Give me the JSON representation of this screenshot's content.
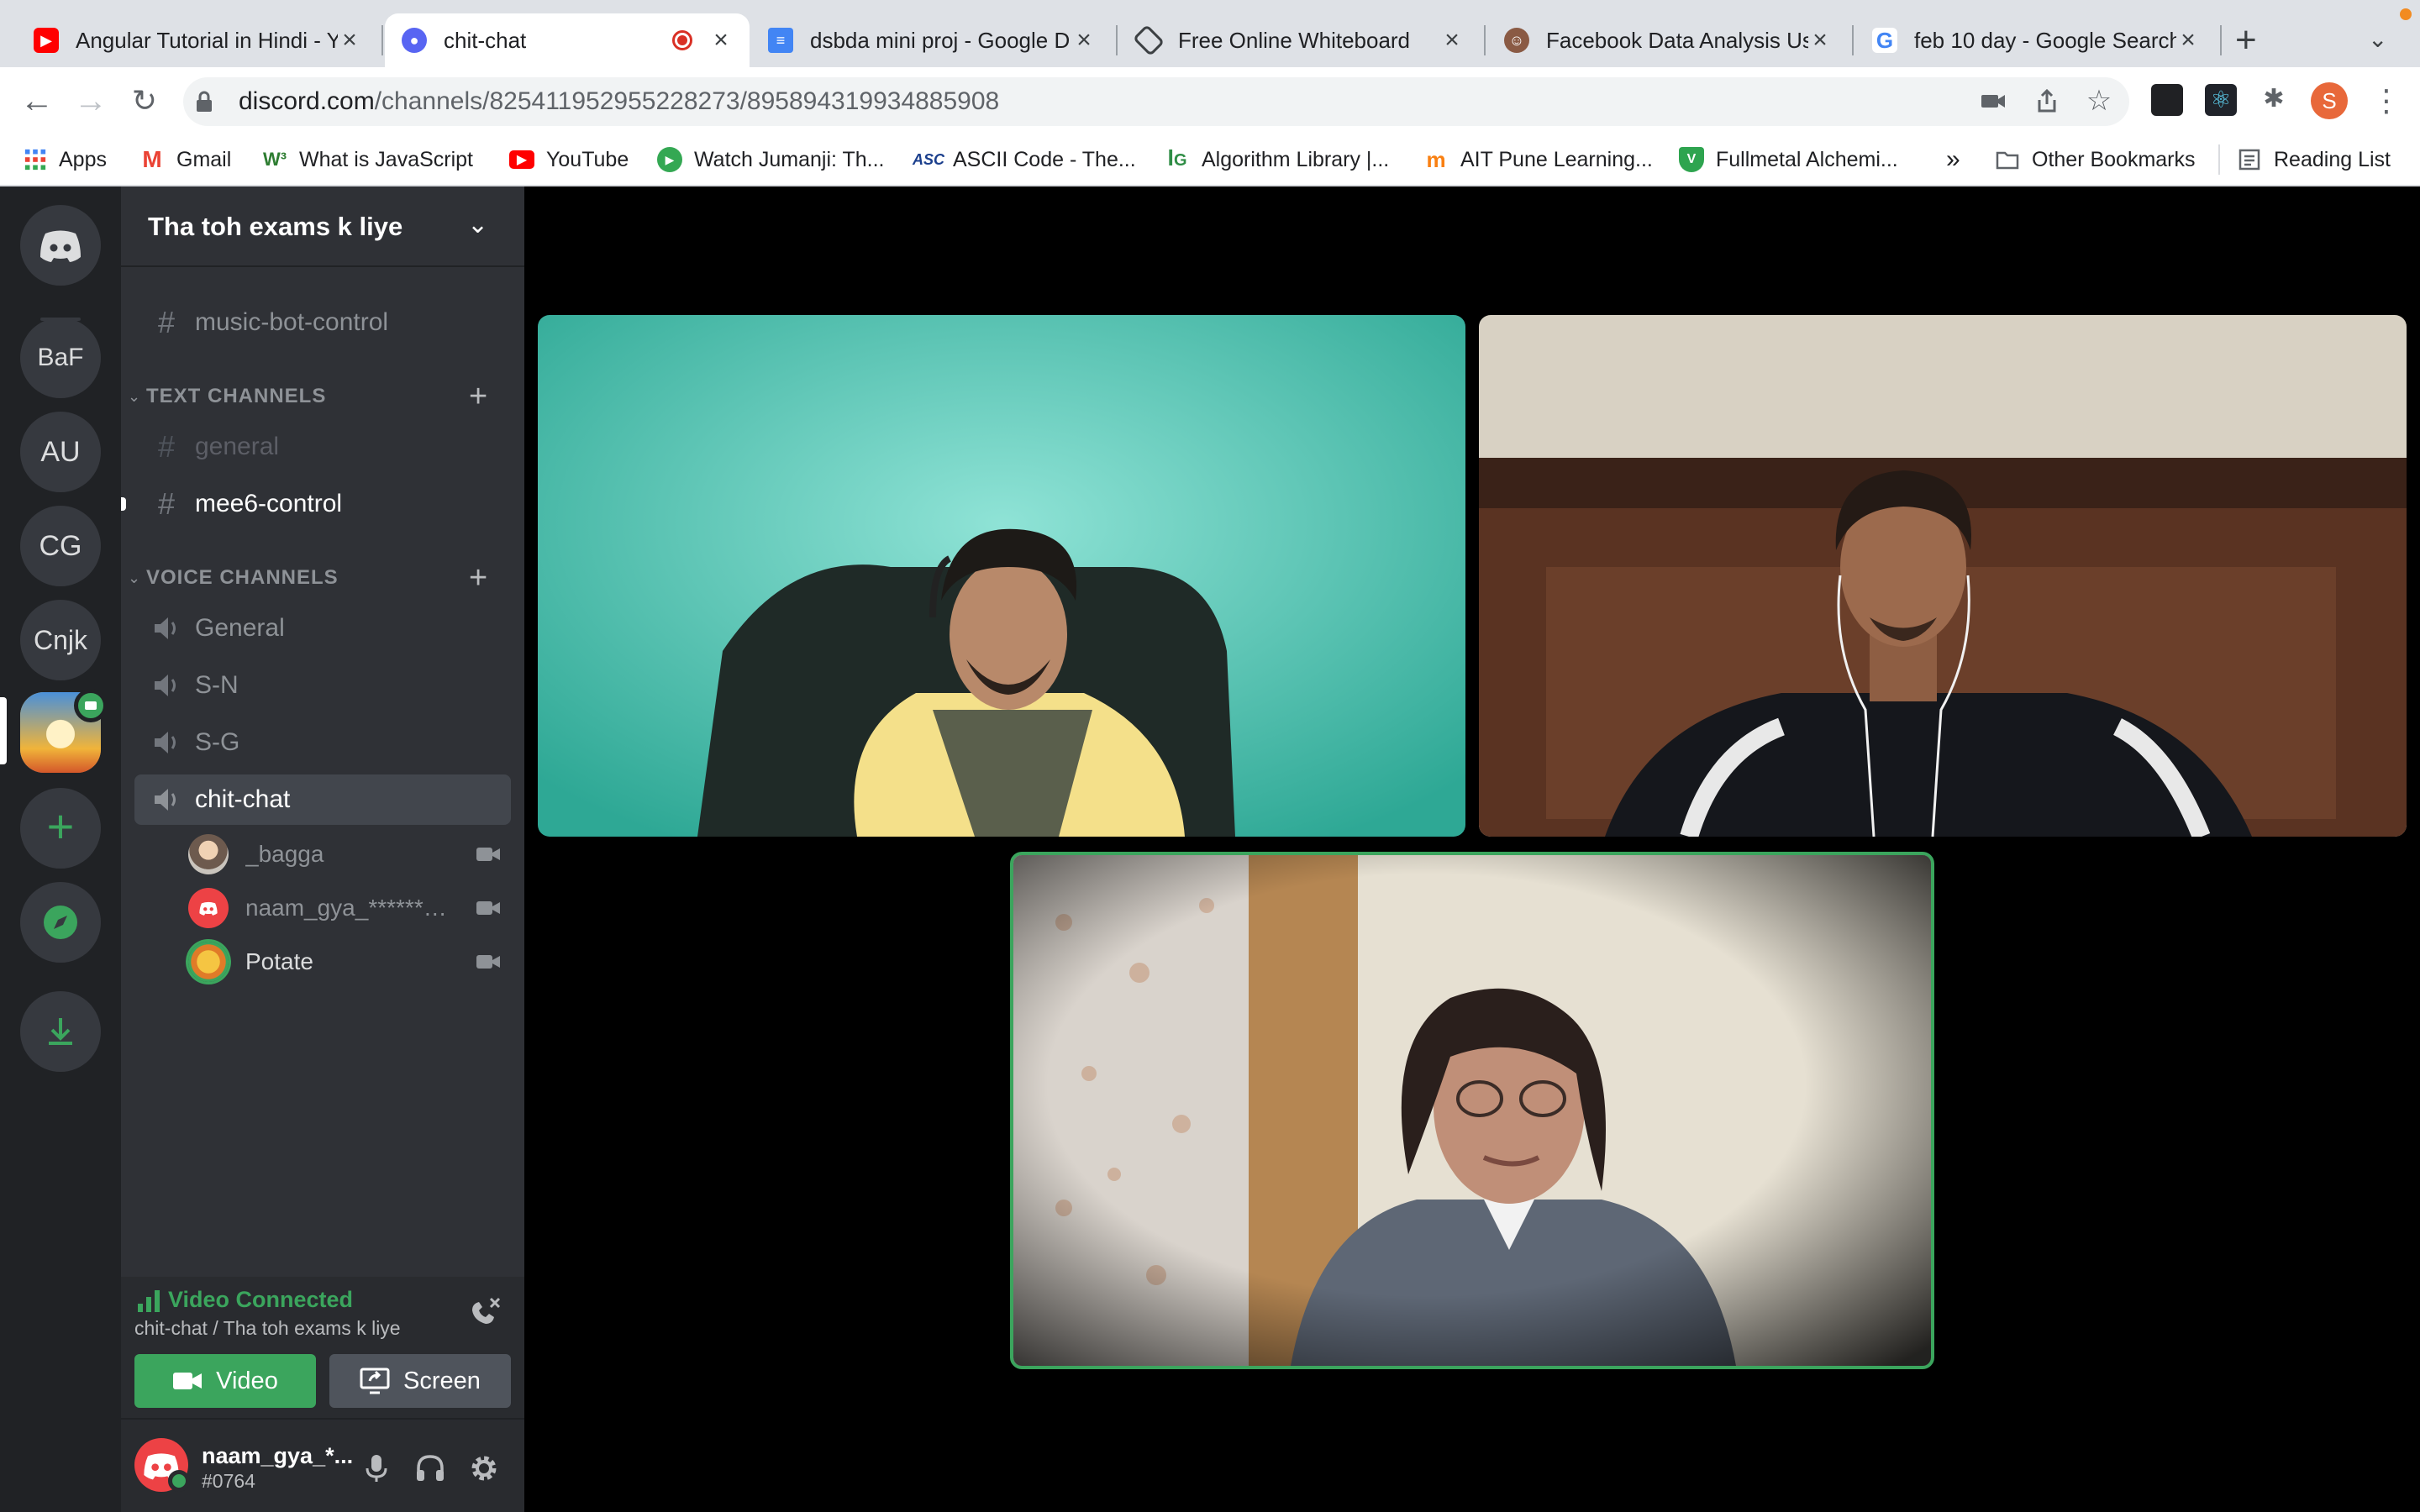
{
  "browser": {
    "tabs": [
      {
        "title": "Angular Tutorial in Hindi - Y",
        "favicon": "youtube-icon",
        "color": "#ff0000"
      },
      {
        "title": "chit-chat",
        "favicon": "discord-icon",
        "color": "#5865f2",
        "recording": true
      },
      {
        "title": "dsbda mini proj - Google D",
        "favicon": "google-docs-icon",
        "color": "#4285f4"
      },
      {
        "title": "Free Online Whiteboard",
        "favicon": "whiteboard-icon",
        "color": "#3c4043"
      },
      {
        "title": "Facebook Data Analysis Us",
        "favicon": "avatar-icon",
        "color": "#8a5a44"
      },
      {
        "title": "feb 10 day - Google Search",
        "favicon": "google-icon",
        "color": "#4285f4"
      }
    ],
    "address": {
      "host": "discord.com",
      "path": "/channels/825411952955228273/895894319934885908"
    },
    "profile_initial": "S",
    "bookmarks": [
      {
        "label": "Apps",
        "icon": "apps-grid-icon"
      },
      {
        "label": "Gmail",
        "icon": "gmail-icon"
      },
      {
        "label": "What is JavaScript",
        "icon": "w3-icon"
      },
      {
        "label": "YouTube",
        "icon": "youtube-icon"
      },
      {
        "label": "Watch Jumanji: Th...",
        "icon": "play-icon"
      },
      {
        "label": "ASCII Code - The...",
        "icon": "ascii-icon"
      },
      {
        "label": "Algorithm Library |...",
        "icon": "gfg-icon"
      },
      {
        "label": "AIT Pune Learning...",
        "icon": "moodle-icon"
      },
      {
        "label": "Fullmetal Alchemi...",
        "icon": "shield-icon"
      }
    ],
    "overflow_label": "»",
    "other_bookmarks": "Other Bookmarks",
    "reading_list": "Reading List"
  },
  "servers": [
    "BaF",
    "AU",
    "CG",
    "Cnjk"
  ],
  "server": {
    "name": "Tha toh exams k liye",
    "top_channel": "music-bot-control",
    "text_category": "TEXT CHANNELS",
    "text_channels": [
      "general",
      "mee6-control"
    ],
    "voice_category": "VOICE CHANNELS",
    "voice_channels": [
      "General",
      "S-N",
      "S-G",
      "chit-chat"
    ],
    "voice_users": [
      "_bagga",
      "naam_gya_*********...",
      "Potate"
    ]
  },
  "rtc": {
    "status": "Video Connected",
    "location": "chit-chat / Tha toh exams k liye",
    "video_label": "Video",
    "screen_label": "Screen"
  },
  "user": {
    "name": "naam_gya_*...",
    "tag": "#0764"
  },
  "colors": {
    "green": "#3ba55d",
    "blurple": "#5865f2",
    "red": "#ed4245"
  }
}
